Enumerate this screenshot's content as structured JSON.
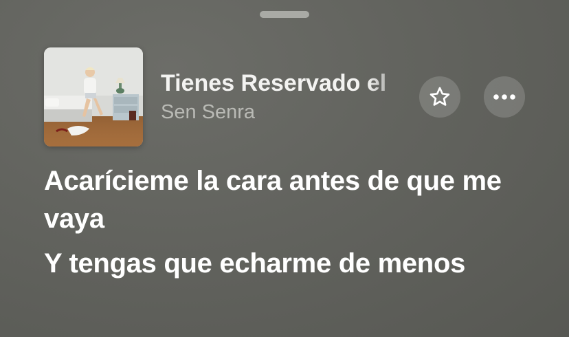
{
  "sheet": {
    "grabber": "drag-handle"
  },
  "now_playing": {
    "title": "Tienes Reservado el",
    "artist": "Sen Senra",
    "artwork": "album-cover-bedroom-photo",
    "favorite_icon": "star-icon",
    "more_icon": "ellipsis-icon"
  },
  "lyrics": {
    "lines": [
      "Acarícieme la cara antes de que me vaya",
      "Y tengas que echarme de menos"
    ]
  },
  "colors": {
    "background": "#62635e",
    "title": "#f3f3f1",
    "artist": "#b9bab5",
    "button_fill": "rgba(255,255,255,0.16)"
  }
}
